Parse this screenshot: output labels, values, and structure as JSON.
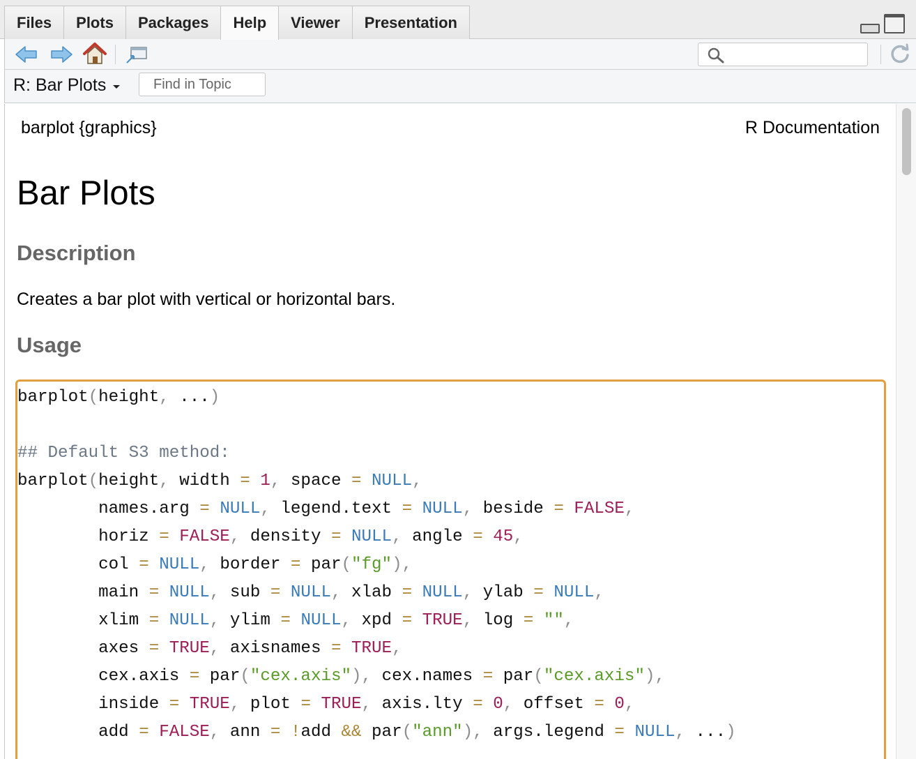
{
  "tabs": [
    {
      "label": "Files"
    },
    {
      "label": "Plots"
    },
    {
      "label": "Packages"
    },
    {
      "label": "Help",
      "active": true
    },
    {
      "label": "Viewer"
    },
    {
      "label": "Presentation"
    }
  ],
  "toolbar": {
    "icons": [
      "back-arrow-icon",
      "forward-arrow-icon",
      "home-icon",
      "popout-window-icon",
      "search-icon",
      "refresh-icon"
    ],
    "search_value": ""
  },
  "topic": {
    "title": "R: Bar Plots",
    "find_placeholder": "Find in Topic"
  },
  "doc": {
    "package_label": "barplot {graphics}",
    "doc_label": "R Documentation",
    "title": "Bar Plots",
    "description_heading": "Description",
    "description_text": "Creates a bar plot with vertical or horizontal bars.",
    "usage_heading": "Usage",
    "usage_lines": [
      "barplot(height, ...)",
      "",
      "## Default S3 method:",
      "barplot(height, width = 1, space = NULL,",
      "        names.arg = NULL, legend.text = NULL, beside = FALSE,",
      "        horiz = FALSE, density = NULL, angle = 45,",
      "        col = NULL, border = par(\"fg\"),",
      "        main = NULL, sub = NULL, xlab = NULL, ylab = NULL,",
      "        xlim = NULL, ylim = NULL, xpd = TRUE, log = \"\",",
      "        axes = TRUE, axisnames = TRUE,",
      "        cex.axis = par(\"cex.axis\"), cex.names = par(\"cex.axis\"),",
      "        inside = TRUE, plot = TRUE, axis.lty = 0, offset = 0,",
      "        add = FALSE, ann = !add && par(\"ann\"), args.legend = NULL, ...)"
    ]
  },
  "colors": {
    "focus_border": "#e0a040",
    "code_keyword": "#9e1e57",
    "code_null": "#3b7bb8",
    "code_string": "#5a9a28",
    "code_operator": "#a88535",
    "code_comment": "#6c7788",
    "heading_gray": "#666666"
  }
}
